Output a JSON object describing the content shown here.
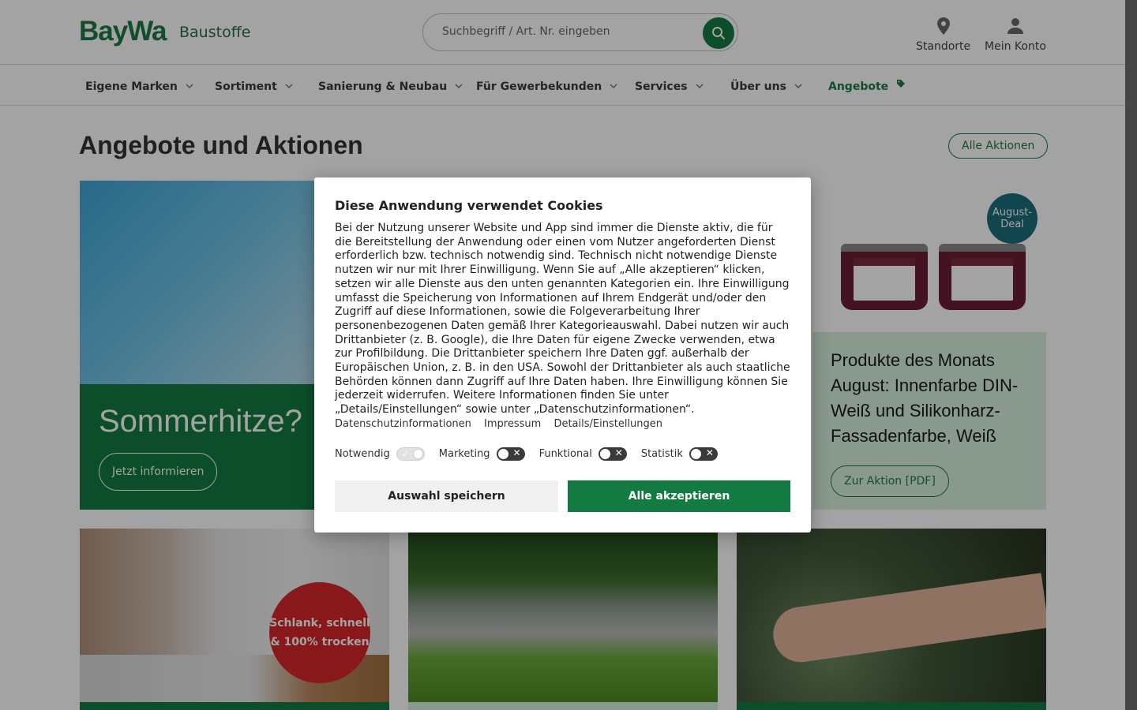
{
  "header": {
    "logo_text": "BayWa",
    "brand_subtitle": "Baustoffe",
    "search_placeholder": "Suchbegriff / Art. Nr. eingeben",
    "locations_label": "Standorte",
    "account_label": "Mein Konto"
  },
  "nav": {
    "items": [
      {
        "label": "Eigene Marken"
      },
      {
        "label": "Sortiment"
      },
      {
        "label": "Sanierung & Neubau"
      },
      {
        "label": "Für Gewerbekunden"
      },
      {
        "label": "Services"
      },
      {
        "label": "Über uns"
      },
      {
        "label": "Angebote"
      }
    ]
  },
  "main": {
    "title": "Angebote und Aktionen",
    "all_actions_label": "Alle Aktionen",
    "cards": [
      {
        "heading": "Sommerhitze?",
        "button": "Jetzt informieren"
      },
      {
        "badge": "August-\nDeal",
        "heading": "Produkte des Monats August: Innenfarbe DIN-Weiß und Silikonharz-Fassadenfarbe, Weiß",
        "button": "Zur Aktion [PDF]"
      },
      {
        "badge": "Schlank, schnell & 100% trocken"
      },
      {},
      {}
    ]
  },
  "cookie": {
    "title": "Diese Anwendung verwendet Cookies",
    "body": "Bei der Nutzung unserer Website und App sind immer die Dienste aktiv, die für die Bereitstellung der Anwendung oder einen vom Nutzer angeforderten Dienst erforderlich bzw. technisch notwendig sind. Technisch nicht notwendige Dienste nutzen wir nur mit Ihrer Einwilligung. Wenn Sie auf „Alle akzeptieren“ klicken, setzen wir alle Dienste aus den unten genannten Kategorien ein. Ihre Einwilligung umfasst die Speicherung von Informationen auf Ihrem Endgerät und/oder den Zugriff auf diese Informationen, sowie die Folgeverarbeitung Ihrer personenbezogenen Daten gemäß Ihrer Kategorieauswahl. Dabei nutzen wir auch Drittanbieter (z. B. Google), die Ihre Daten für eigene Zwecke verwenden, etwa zur Profilbildung. Die Drittanbieter speichern Ihre Daten ggf. außerhalb der Europäischen Union, z. B. in den USA. Sowohl der Drittanbieter als auch staatliche Behörden können dann Zugriff auf Ihre Daten haben. Ihre Einwilligung können Sie jederzeit widerrufen. Weitere Informationen finden Sie unter „Details/Einstellungen“ sowie unter „Datenschutzinformationen“.",
    "links": [
      "Datenschutzinformationen",
      "Impressum",
      "Details/Einstellungen"
    ],
    "toggles": [
      {
        "label": "Notwendig",
        "state": "on-locked"
      },
      {
        "label": "Marketing",
        "state": "off"
      },
      {
        "label": "Funktional",
        "state": "off"
      },
      {
        "label": "Statistik",
        "state": "off"
      }
    ],
    "save_label": "Auswahl speichern",
    "accept_label": "Alle akzeptieren"
  },
  "colors": {
    "brand_green": "#137a41",
    "light_green": "#d6f0dd",
    "deal_badge": "#1d6e7a",
    "red_badge": "#d7262b"
  }
}
